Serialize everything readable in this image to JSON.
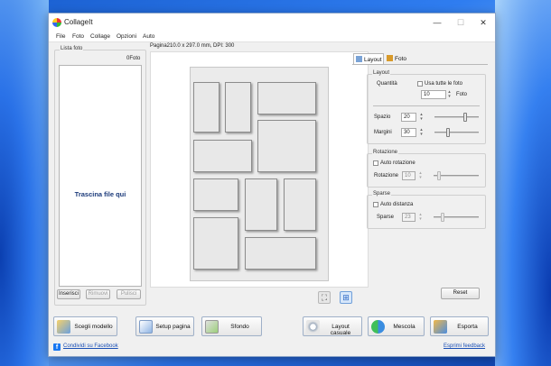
{
  "window": {
    "title": "CollageIt"
  },
  "menu": [
    "File",
    "Foto",
    "Collage",
    "Opzioni",
    "Auto"
  ],
  "photos": {
    "group_label": "Lista foto",
    "count": "0Foto",
    "drop_text": "Trascina file qui",
    "insert_label": "Inserisci",
    "remove_label": "Rimuovi",
    "clear_label": "Pulisci"
  },
  "page_info": "Pagina210.0 x 297.0 mm, DPI: 300",
  "tabs": {
    "layout": "Layout",
    "photo": "Foto"
  },
  "layout": {
    "group_label": "Layout",
    "quantity_label": "Quantità",
    "use_all_label": "Usa tutte le foto",
    "quantity_value": "10",
    "photos_unit": "Foto",
    "spacing_label": "Spazio",
    "spacing_value": "20",
    "margins_label": "Margini",
    "margins_value": "30"
  },
  "rotation": {
    "group_label": "Rotazione",
    "auto_label": "Auto rotazione",
    "value_label": "Rotazione",
    "value": "10"
  },
  "scatter": {
    "group_label": "Sparse",
    "auto_label": "Auto distanza",
    "value_label": "Sparse",
    "value": "23"
  },
  "reset_label": "Reset",
  "actions": {
    "choose_template": "Scegli modello",
    "page_setup": "Setup pagina",
    "background": "Sfondo",
    "random_layout": "Layout casuale",
    "shuffle": "Mescola",
    "export": "Esporta"
  },
  "footer": {
    "facebook": "Condividi su Facebook",
    "feedback": "Esprimi feedback"
  }
}
